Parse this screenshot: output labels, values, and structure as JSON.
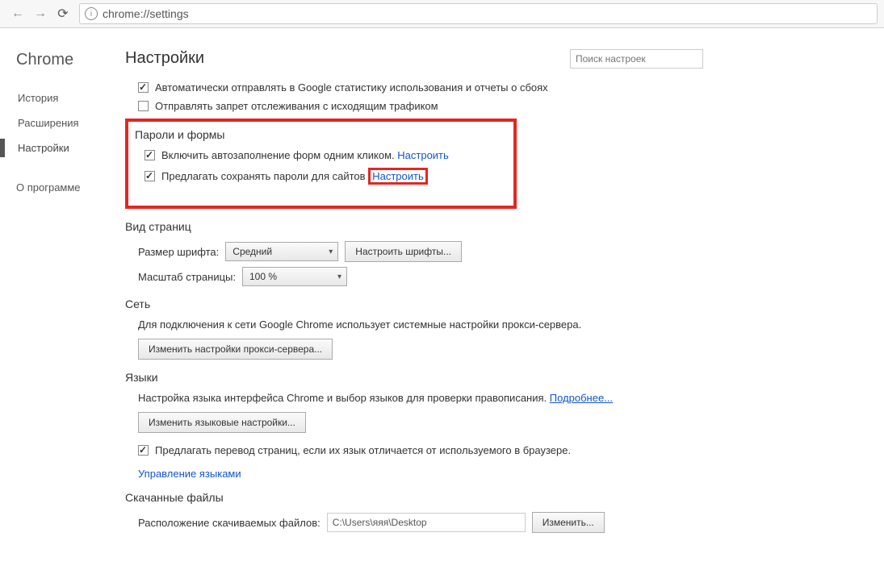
{
  "toolbar": {
    "url": "chrome://settings"
  },
  "sidebar": {
    "brand": "Chrome",
    "items": [
      "История",
      "Расширения",
      "Настройки"
    ],
    "about": "О программе"
  },
  "header": {
    "title": "Настройки",
    "search_placeholder": "Поиск настроек"
  },
  "top_checks": {
    "stats_label": "Автоматически отправлять в Google статистику использования и отчеты о сбоях",
    "dnt_label": "Отправлять запрет отслеживания с исходящим трафиком"
  },
  "passwords": {
    "heading": "Пароли и формы",
    "autofill_label": "Включить автозаполнение форм одним кликом.",
    "autofill_link": "Настроить",
    "savepw_label": "Предлагать сохранять пароли для сайтов",
    "savepw_link": "Настроить"
  },
  "webcontent": {
    "heading": "Вид страниц",
    "fontsize_label": "Размер шрифта:",
    "fontsize_value": "Средний",
    "customize_fonts_btn": "Настроить шрифты...",
    "zoom_label": "Масштаб страницы:",
    "zoom_value": "100 %"
  },
  "network": {
    "heading": "Сеть",
    "desc": "Для подключения к сети Google Chrome использует системные настройки прокси-сервера.",
    "proxy_btn": "Изменить настройки прокси-сервера..."
  },
  "languages": {
    "heading": "Языки",
    "desc_prefix": "Настройка языка интерфейса Chrome и выбор языков для проверки правописания.",
    "desc_link": "Подробнее...",
    "lang_settings_btn": "Изменить языковые настройки...",
    "translate_label": "Предлагать перевод страниц, если их язык отличается от используемого в браузере.",
    "manage_link": "Управление языками"
  },
  "downloads": {
    "heading": "Скачанные файлы",
    "loc_label": "Расположение скачиваемых файлов:",
    "loc_value": "C:\\Users\\яяя\\Desktop",
    "change_btn": "Изменить..."
  }
}
